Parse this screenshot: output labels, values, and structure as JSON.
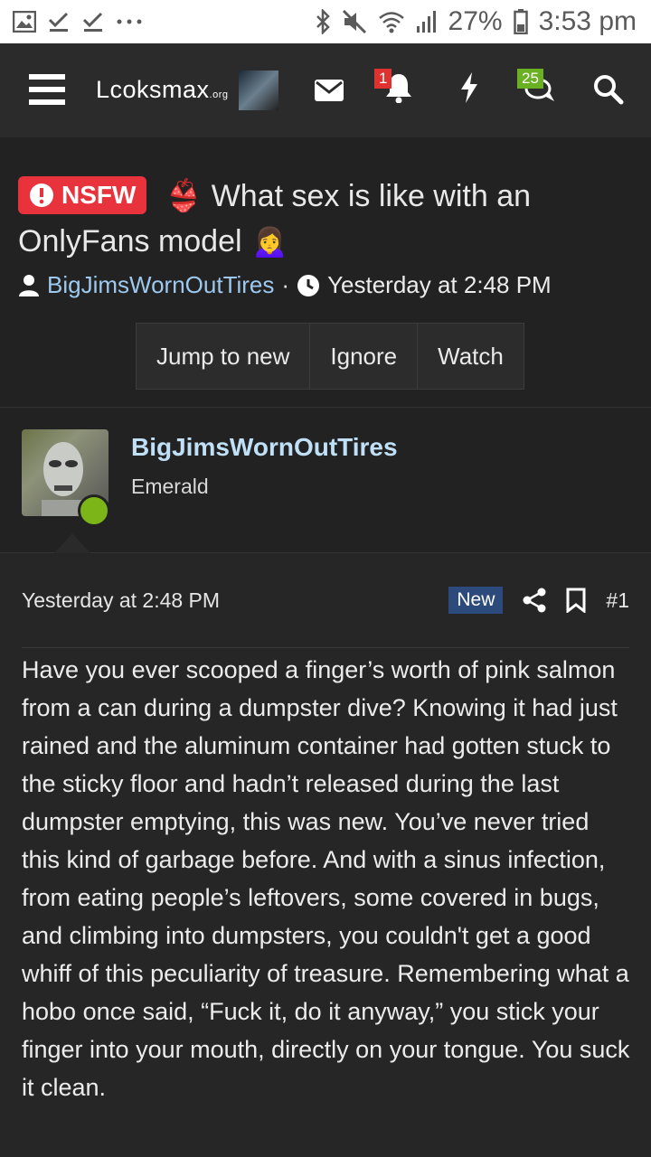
{
  "status_bar": {
    "battery": "27%",
    "time": "3:53 pm",
    "icons": [
      "image-icon",
      "check-icon",
      "check-icon",
      "more-icon",
      "bluetooth-icon",
      "mute-icon",
      "wifi-icon",
      "signal-icon",
      "battery-icon"
    ]
  },
  "navbar": {
    "logo": "Lcoksmax",
    "logo_suffix": ".org",
    "notifications_count": "1",
    "conversations_count": "25",
    "icons": [
      "menu-icon",
      "mail-icon",
      "bell-icon",
      "lightning-icon",
      "chat-icon",
      "search-icon"
    ]
  },
  "thread": {
    "prefix": "NSFW",
    "title": "What sex is like with an OnlyFans model",
    "emoji_bra": "👙",
    "emoji_person": "🙍‍♀️",
    "author": "BigJimsWornOutTires",
    "separator": "·",
    "date": "Yesterday at 2:48 PM"
  },
  "actions": {
    "jump": "Jump to new",
    "ignore": "Ignore",
    "watch": "Watch"
  },
  "post": {
    "username": "BigJimsWornOutTires",
    "rank": "Emerald",
    "date": "Yesterday at 2:48 PM",
    "new_label": "New",
    "number": "#1",
    "body": "Have you ever scooped a finger’s worth of pink salmon from a can during a dumpster dive? Knowing it had just rained and the aluminum container had gotten stuck to the sticky floor and hadn’t released during the last dumpster emptying, this was new. You’ve never tried this kind of garbage before. And with a sinus infection, from eating people’s leftovers, some covered in bugs, and climbing into dumpsters, you couldn't get a good whiff of this peculiarity of treasure. Remembering what a hobo once said, “Fuck it, do it anyway,” you stick your finger into your mouth, directly on your tongue. You suck it clean."
  },
  "colors": {
    "accent_red": "#e8323c",
    "link_blue": "#9ec9ee",
    "online_green": "#7cb518",
    "new_badge": "#2d4a7c"
  }
}
